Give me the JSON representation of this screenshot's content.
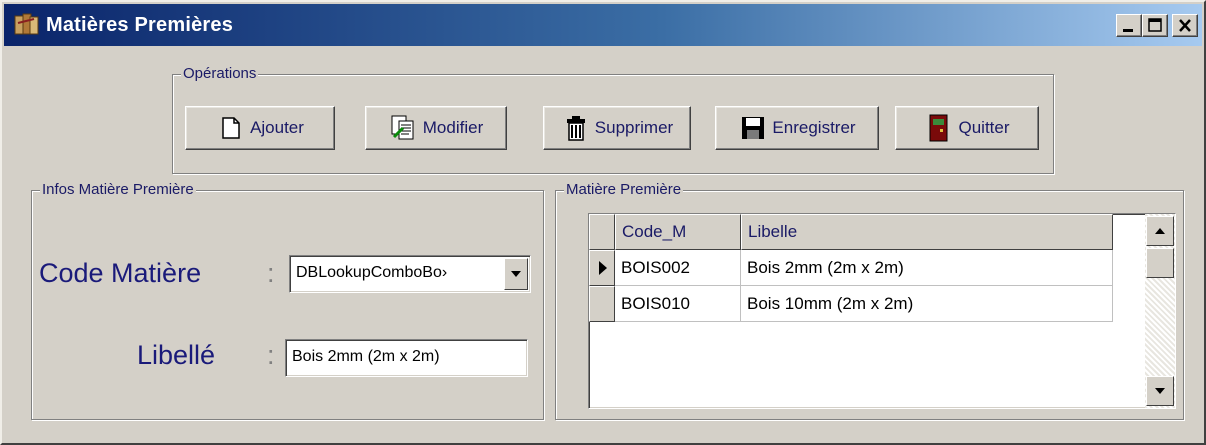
{
  "window": {
    "title": "Matières Premières"
  },
  "operations": {
    "label": "Opérations",
    "buttons": [
      {
        "label": "Ajouter",
        "icon": "new-document-icon"
      },
      {
        "label": "Modifier",
        "icon": "edit-document-icon"
      },
      {
        "label": "Supprimer",
        "icon": "trash-icon"
      },
      {
        "label": "Enregistrer",
        "icon": "floppy-disk-icon"
      },
      {
        "label": "Quitter",
        "icon": "exit-door-icon"
      }
    ]
  },
  "infos": {
    "label": "Infos Matière Première",
    "code_label": "Code Matière",
    "code_colon": ":",
    "code_value": "DBLookupComboBo›",
    "libelle_label": "Libellé",
    "libelle_colon": ":",
    "libelle_value": "Bois 2mm (2m x 2m)"
  },
  "grid": {
    "label": "Matière Première",
    "columns": [
      "Code_M",
      "Libelle"
    ],
    "rows": [
      {
        "code": "BOIS002",
        "libelle": "Bois 2mm (2m x 2m)",
        "current": true
      },
      {
        "code": "BOIS010",
        "libelle": "Bois 10mm (2m x 2m)",
        "current": false
      }
    ]
  },
  "colors": {
    "titlebar_start": "#0a246a",
    "titlebar_end": "#a6caf0",
    "face": "#d4d0c8",
    "label_text": "#1a1a66"
  }
}
